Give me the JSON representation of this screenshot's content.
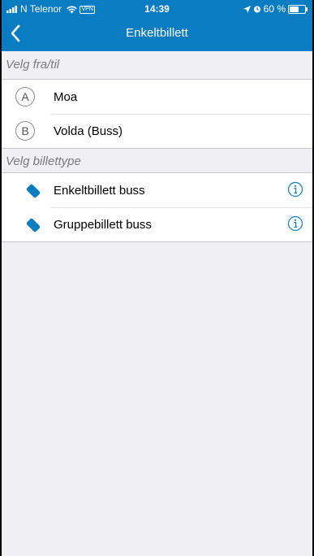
{
  "status_bar": {
    "carrier": "N Telenor",
    "vpn": "VPN",
    "time": "14:39",
    "battery": "60 %",
    "battery_level": 0.6
  },
  "nav": {
    "title": "Enkeltbillett",
    "back_icon": "chevron-left-icon"
  },
  "route_section": {
    "header": "Velg fra/til",
    "from": {
      "letter": "A",
      "name": "Moa"
    },
    "to": {
      "letter": "B",
      "name": "Volda (Buss)"
    }
  },
  "ticket_section": {
    "header": "Velg billettype",
    "items": [
      {
        "label": "Enkeltbillett buss",
        "icon": "ticket-icon",
        "info_icon": "info-icon"
      },
      {
        "label": "Gruppebillett buss",
        "icon": "ticket-icon",
        "info_icon": "info-icon"
      }
    ]
  },
  "colors": {
    "brand": "#0a7cc1",
    "background": "#efeff4",
    "ticket_icon": "#0a7cc1"
  }
}
